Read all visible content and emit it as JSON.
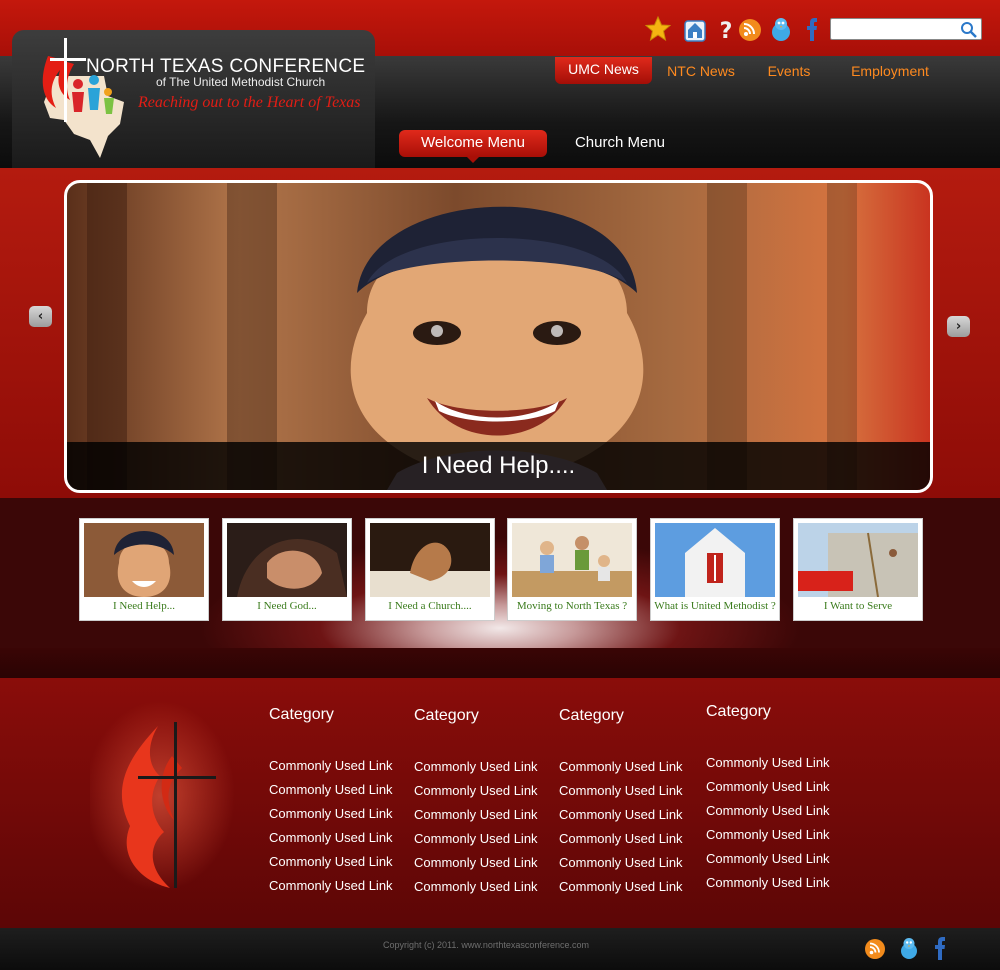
{
  "brand": {
    "title": "NORTH TEXAS CONFERENCE",
    "subtitle": "of The United Methodist Church",
    "tagline": "Reaching out to the Heart of Texas"
  },
  "top_icons": [
    "star-icon",
    "home-icon",
    "help-icon",
    "rss-icon",
    "twitter-bird-icon",
    "facebook-icon"
  ],
  "search": {
    "value": "",
    "placeholder": ""
  },
  "nav": {
    "items": [
      {
        "label": "UMC News",
        "active": true
      },
      {
        "label": "NTC News",
        "active": false
      },
      {
        "label": "Events",
        "active": false
      },
      {
        "label": "Employment",
        "active": false
      }
    ]
  },
  "menu_tabs": [
    {
      "label": "Welcome Menu",
      "active": true
    },
    {
      "label": "Church Menu",
      "active": false
    }
  ],
  "hero": {
    "caption": "I Need Help...."
  },
  "thumbnails": [
    {
      "caption": "I Need Help..."
    },
    {
      "caption": "I Need  God..."
    },
    {
      "caption": "I Need  a  Church...."
    },
    {
      "caption": "Moving to North Texas ?"
    },
    {
      "caption": "What is  United Methodist ?"
    },
    {
      "caption": "I Want to Serve"
    }
  ],
  "footer": {
    "columns": [
      {
        "title": "Category",
        "links": [
          "Commonly Used Link",
          "Commonly Used Link",
          "Commonly Used Link",
          "Commonly Used Link",
          "Commonly Used Link",
          "Commonly Used Link"
        ]
      },
      {
        "title": "Category",
        "links": [
          "Commonly Used Link",
          "Commonly Used Link",
          "Commonly Used Link",
          "Commonly Used Link",
          "Commonly Used Link",
          "Commonly Used Link"
        ]
      },
      {
        "title": "Category",
        "links": [
          "Commonly Used Link",
          "Commonly Used Link",
          "Commonly Used Link",
          "Commonly Used Link",
          "Commonly Used Link",
          "Commonly Used Link"
        ]
      },
      {
        "title": "Category",
        "links": [
          "Commonly Used Link",
          "Commonly Used Link",
          "Commonly Used Link",
          "Commonly Used Link",
          "Commonly Used Link",
          "Commonly Used Link"
        ]
      }
    ],
    "copyright": "Copyright (c) 2011. www.northtexasconference.com",
    "social_icons": [
      "rss-icon",
      "twitter-bird-icon",
      "facebook-icon"
    ]
  },
  "colors": {
    "brand_red": "#c4180c",
    "accent_orange": "#ff8a1f",
    "link_green": "#3a7b1c"
  }
}
